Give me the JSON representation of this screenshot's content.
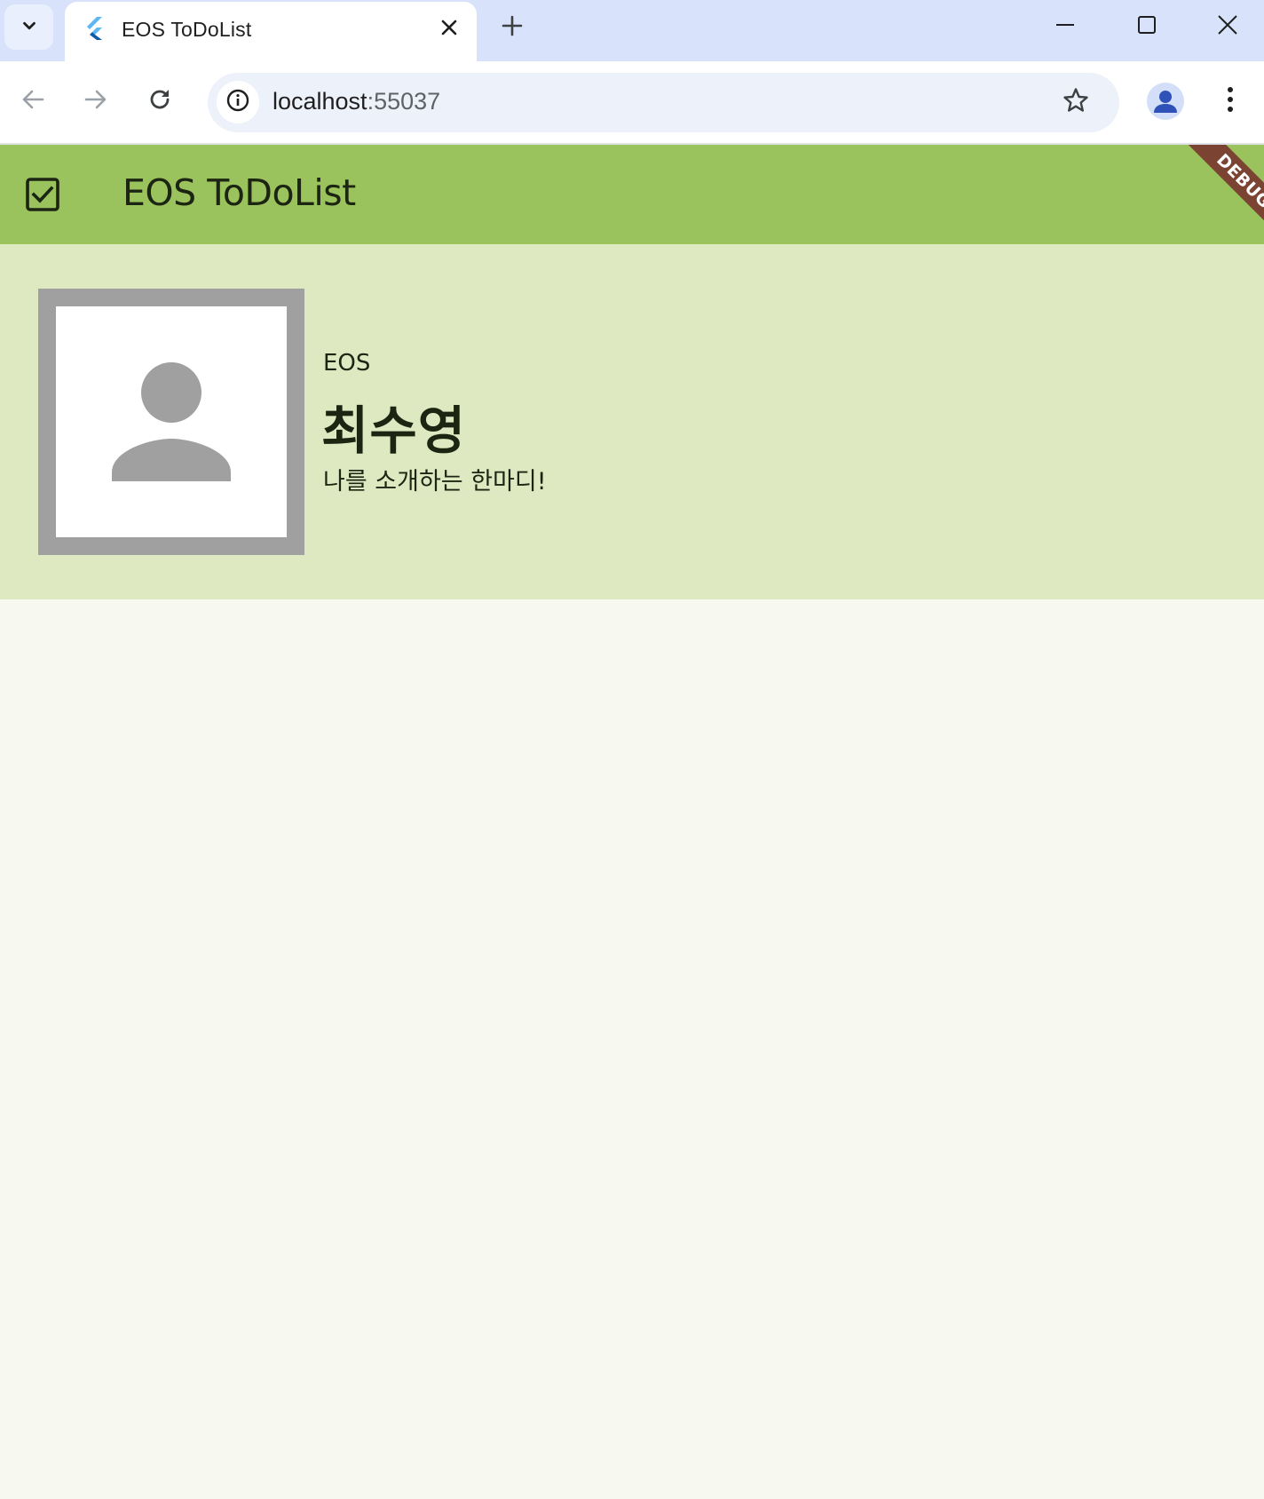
{
  "browser": {
    "tab": {
      "title": "EOS ToDoList",
      "favicon": "flutter-icon"
    },
    "url": {
      "host": "localhost",
      "port": ":55037"
    },
    "icons": {
      "tab_search": "chevron-down-icon",
      "tab_close": "close-icon",
      "new_tab": "plus-icon",
      "minimize": "minimize-icon",
      "maximize": "maximize-icon",
      "window_close": "close-icon",
      "back": "arrow-left-icon",
      "forward": "arrow-right-icon",
      "reload": "reload-icon",
      "site_info": "info-icon",
      "bookmark": "star-icon",
      "profile": "person-icon",
      "menu": "more-vert-icon"
    }
  },
  "app": {
    "title": "EOS ToDoList",
    "leading_icon": "check-box-icon",
    "debug_banner": "DEBUG",
    "colors": {
      "app_bar": "#9bc35d",
      "profile_card": "#dee9c1",
      "background": "#f7f8f0",
      "debug_banner": "#7b4432",
      "avatar_border": "#a0a0a0"
    }
  },
  "profile": {
    "avatar_icon": "person-icon",
    "organization": "EOS",
    "name": "최수영",
    "intro": "나를 소개하는 한마디!"
  }
}
